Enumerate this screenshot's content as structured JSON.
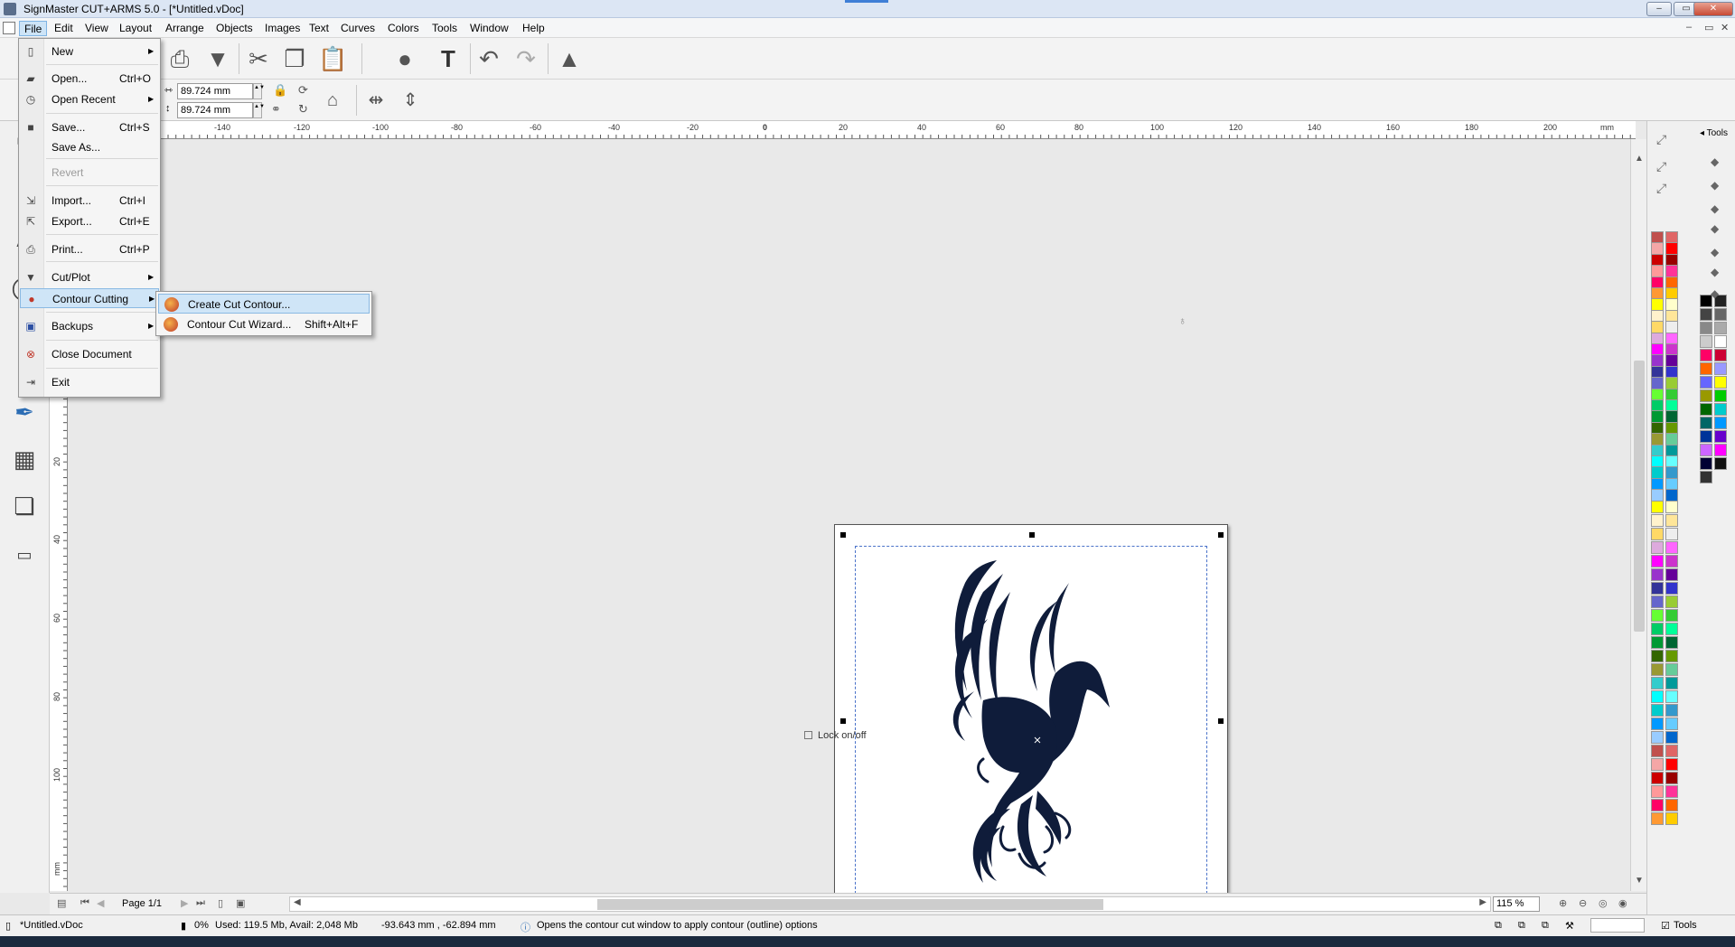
{
  "window": {
    "title": "SignMaster CUT+ARMS 5.0 - [*Untitled.vDoc]",
    "min_glyph": "–",
    "max_glyph": "▭",
    "close_glyph": "✕"
  },
  "menubar": {
    "items": [
      "File",
      "Edit",
      "View",
      "Layout",
      "Arrange",
      "Objects",
      "Images",
      "Text",
      "Curves",
      "Colors",
      "Tools",
      "Window",
      "Help"
    ]
  },
  "dimensions": {
    "width": "89.724 mm",
    "height": "89.724 mm"
  },
  "ruler": {
    "unit": "mm",
    "h_labels": [
      "-140",
      "-120",
      "-100",
      "-80",
      "-60",
      "-40",
      "-20",
      "0",
      "20",
      "40",
      "60",
      "80",
      "100",
      "120",
      "140",
      "160",
      "180",
      "200"
    ],
    "v_labels": [
      "20",
      "40",
      "60",
      "80",
      "100"
    ],
    "v_unit": "mm"
  },
  "file_menu": {
    "items": [
      {
        "label": "New",
        "shortcut": "",
        "submenu": true,
        "disabled": false,
        "icon": "new-doc-icon",
        "glyph": "▯"
      },
      {
        "label": "Open...",
        "shortcut": "Ctrl+O",
        "submenu": false,
        "disabled": false,
        "icon": "open-folder-icon",
        "glyph": "▰"
      },
      {
        "label": "Open Recent",
        "shortcut": "",
        "submenu": true,
        "disabled": false,
        "icon": "recent-icon",
        "glyph": "◷"
      },
      {
        "label": "Save...",
        "shortcut": "Ctrl+S",
        "submenu": false,
        "disabled": false,
        "icon": "save-icon",
        "glyph": "■"
      },
      {
        "label": "Save As...",
        "shortcut": "",
        "submenu": false,
        "disabled": false,
        "icon": "",
        "glyph": ""
      },
      {
        "label": "Revert",
        "shortcut": "",
        "submenu": false,
        "disabled": true,
        "icon": "",
        "glyph": ""
      },
      {
        "label": "Import...",
        "shortcut": "Ctrl+I",
        "submenu": false,
        "disabled": false,
        "icon": "import-icon",
        "glyph": "⇲"
      },
      {
        "label": "Export...",
        "shortcut": "Ctrl+E",
        "submenu": false,
        "disabled": false,
        "icon": "export-icon",
        "glyph": "⇱"
      },
      {
        "label": "Print...",
        "shortcut": "Ctrl+P",
        "submenu": false,
        "disabled": false,
        "icon": "print-icon",
        "glyph": "⎙"
      },
      {
        "label": "Cut/Plot",
        "shortcut": "",
        "submenu": true,
        "disabled": false,
        "icon": "cutplot-icon",
        "glyph": "▼"
      },
      {
        "label": "Contour Cutting",
        "shortcut": "",
        "submenu": true,
        "disabled": false,
        "icon": "contour-icon",
        "glyph": "●"
      },
      {
        "label": "Backups",
        "shortcut": "",
        "submenu": true,
        "disabled": false,
        "icon": "backup-icon",
        "glyph": "▣"
      },
      {
        "label": "Close Document",
        "shortcut": "",
        "submenu": false,
        "disabled": false,
        "icon": "close-doc-icon",
        "glyph": "⊗"
      },
      {
        "label": "Exit",
        "shortcut": "",
        "submenu": false,
        "disabled": false,
        "icon": "exit-icon",
        "glyph": "⇥"
      }
    ],
    "arrow_glyph": "▶"
  },
  "contour_submenu": {
    "items": [
      {
        "label": "Create Cut Contour...",
        "shortcut": ""
      },
      {
        "label": "Contour Cut Wizard...",
        "shortcut": "Shift+Alt+F"
      }
    ]
  },
  "canvas": {
    "lock_hint": "Lock on/off"
  },
  "navigation": {
    "page_label": "Page 1/1",
    "zoom": "115 %"
  },
  "statusbar": {
    "doc_name": "*Untitled.vDoc",
    "progress": "0%",
    "memory": "Used: 119.5 Mb, Avail: 2,048 Mb",
    "coords": "-93.643 mm , -62.894 mm",
    "hint": "Opens the contour cut window to apply contour (outline) options",
    "tools_label": "Tools"
  },
  "tools_panel": {
    "header": "Tools"
  },
  "colors": {
    "brand_dark": "#0f1c3a",
    "accent": "#3f7fd6"
  }
}
